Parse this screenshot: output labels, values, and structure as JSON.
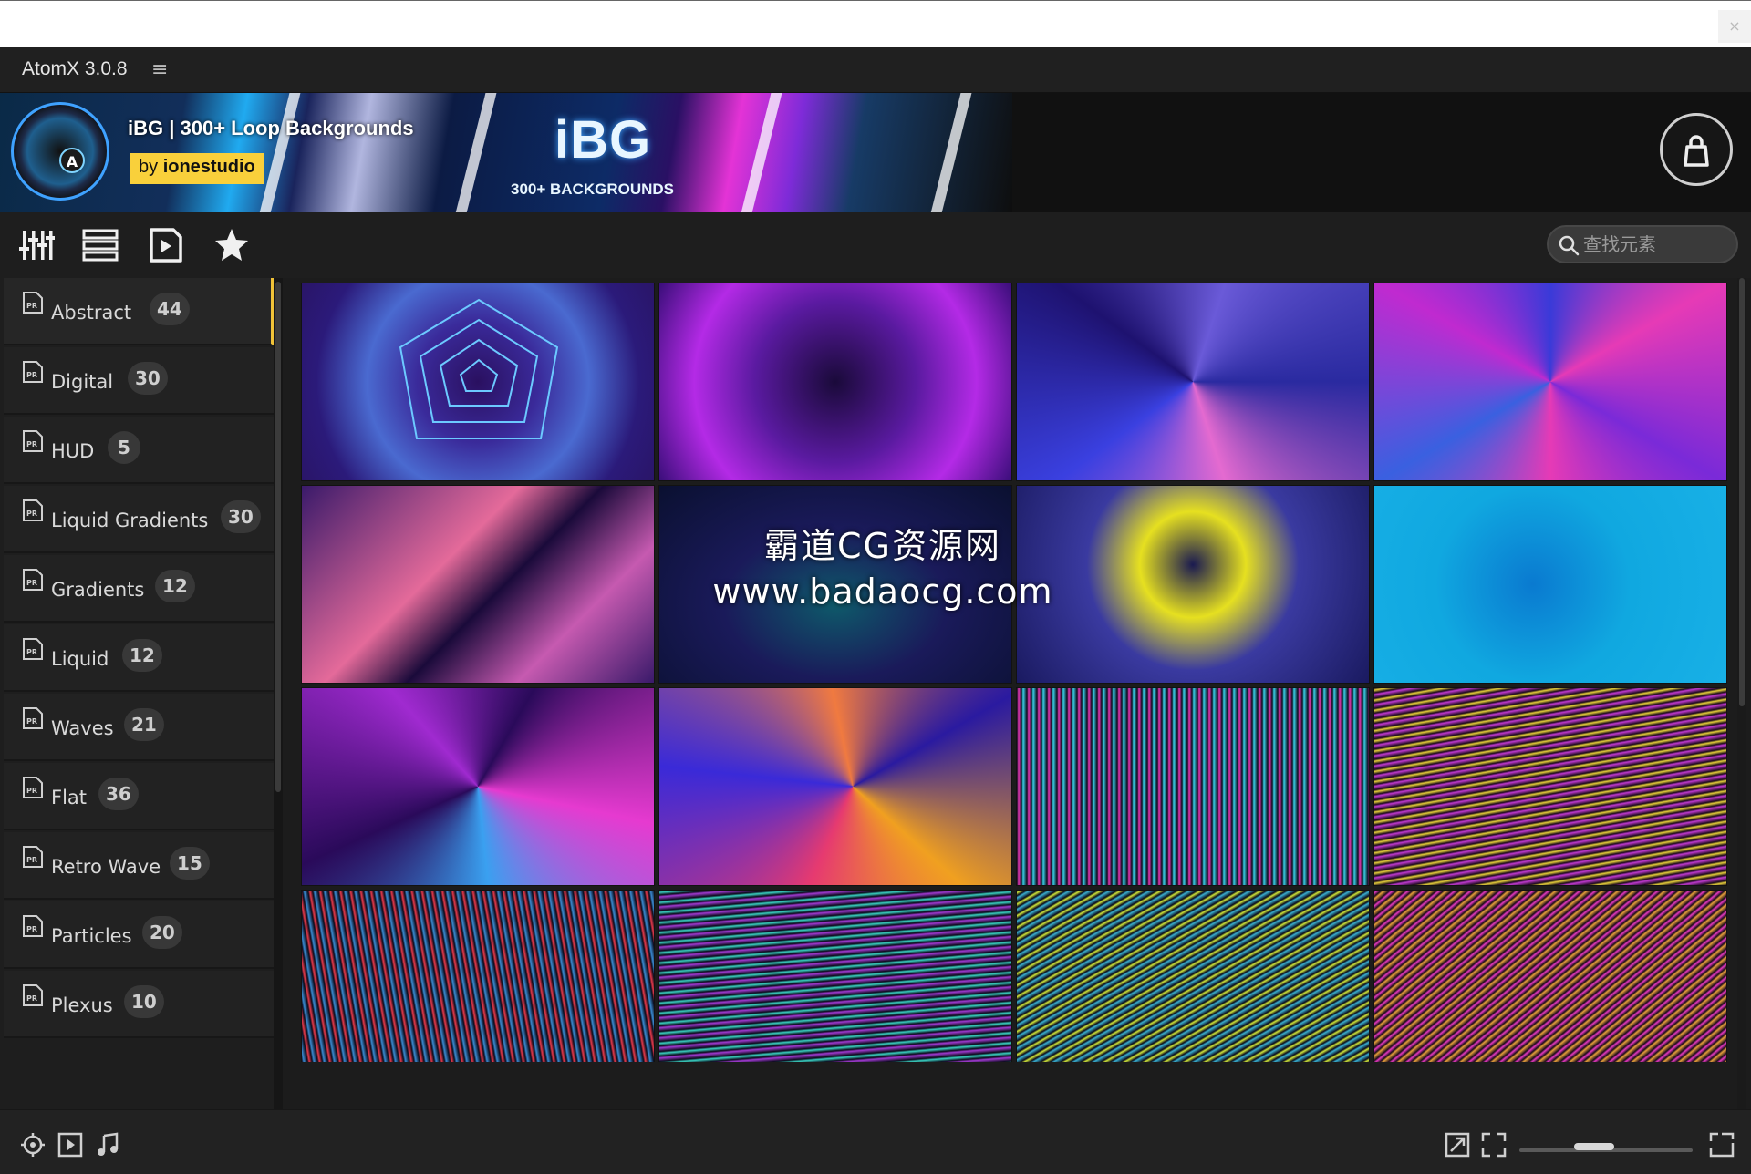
{
  "window": {
    "close_glyph": "×"
  },
  "app": {
    "title": "AtomX 3.0.8",
    "menu_glyph": "≡"
  },
  "banner": {
    "title": "iBG | 300+ Loop Backgrounds",
    "author_prefix": "by",
    "author_name": "ionestudio",
    "art_logo": "iBG",
    "art_subtitle": "300+ BACKGROUNDS",
    "accent": "#f9d03b",
    "shop_icon": "shopping-bag-icon"
  },
  "toolbar": {
    "tools": [
      "sliders-icon",
      "list-icon",
      "video-file-icon",
      "star-icon"
    ],
    "search_placeholder": "查找元素"
  },
  "sidebar": {
    "active_index": 0,
    "accent": "#f0c238",
    "categories": [
      {
        "label": "Abstract",
        "count": "44"
      },
      {
        "label": "Digital",
        "count": "30"
      },
      {
        "label": "HUD",
        "count": "5"
      },
      {
        "label": "Liquid Gradients",
        "count": "30"
      },
      {
        "label": "Gradients",
        "count": "12"
      },
      {
        "label": "Liquid",
        "count": "12"
      },
      {
        "label": "Waves",
        "count": "21"
      },
      {
        "label": "Flat",
        "count": "36"
      },
      {
        "label": "Retro Wave",
        "count": "15"
      },
      {
        "label": "Particles",
        "count": "20"
      },
      {
        "label": "Plexus",
        "count": "10"
      }
    ]
  },
  "watermark": {
    "line1": "霸道CG资源网",
    "line2": "www.badaocg.com"
  },
  "statusbar": {
    "left_icons": [
      "target-icon",
      "play-square-icon",
      "music-note-icon"
    ],
    "right_icons": [
      "expand-icon",
      "fullscreen-icon",
      "layout-icon"
    ]
  }
}
